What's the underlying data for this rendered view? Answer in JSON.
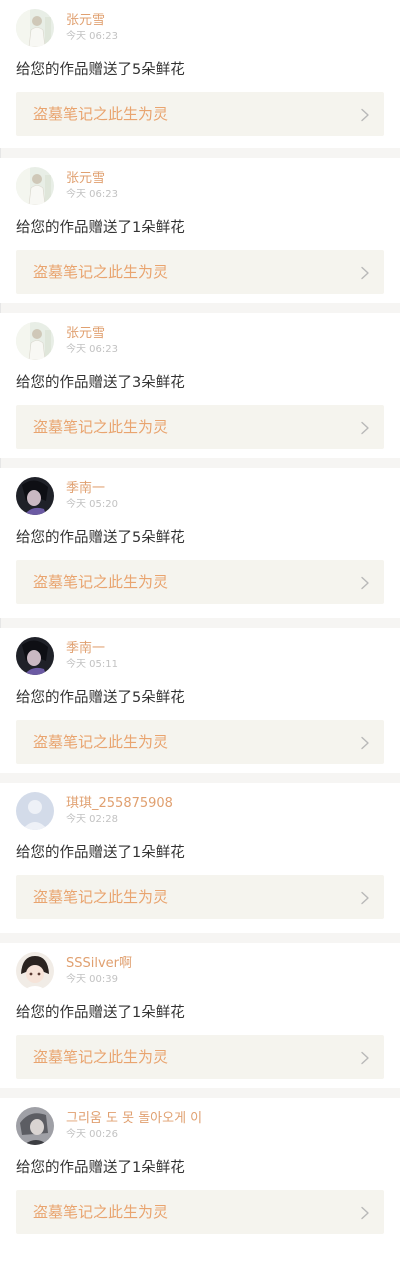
{
  "notifications": [
    {
      "username": "张元雪",
      "time": "今天 06:23",
      "message": "给您的作品赠送了5朵鲜花",
      "work_title": "盗墓笔记之此生为灵",
      "avatar": "avatar-light-figure"
    },
    {
      "username": "张元雪",
      "time": "今天 06:23",
      "message": "给您的作品赠送了1朵鲜花",
      "work_title": "盗墓笔记之此生为灵",
      "avatar": "avatar-light-figure"
    },
    {
      "username": "张元雪",
      "time": "今天 06:23",
      "message": "给您的作品赠送了3朵鲜花",
      "work_title": "盗墓笔记之此生为灵",
      "avatar": "avatar-light-figure"
    },
    {
      "username": "季南一",
      "time": "今天 05:20",
      "message": "给您的作品赠送了5朵鲜花",
      "work_title": "盗墓笔记之此生为灵",
      "avatar": "avatar-dark-portrait"
    },
    {
      "username": "季南一",
      "time": "今天 05:11",
      "message": "给您的作品赠送了5朵鲜花",
      "work_title": "盗墓笔记之此生为灵",
      "avatar": "avatar-dark-portrait"
    },
    {
      "username": "琪琪_255875908",
      "time": "今天 02:28",
      "message": "给您的作品赠送了1朵鲜花",
      "work_title": "盗墓笔记之此生为灵",
      "avatar": "avatar-default-user"
    },
    {
      "username": "SSSilver啊",
      "time": "今天 00:39",
      "message": "给您的作品赠送了1朵鲜花",
      "work_title": "盗墓笔记之此生为灵",
      "avatar": "avatar-anime-girl"
    },
    {
      "username": "그리움 도 못 돌아오게 이",
      "time": "今天 00:26",
      "message": "给您的作品赠送了1朵鲜花",
      "work_title": "盗墓笔记之此生为灵",
      "avatar": "avatar-grey-portrait"
    }
  ],
  "colors": {
    "username": "#e0a070",
    "work_title": "#e9a46f",
    "card_bg": "#f5f4ee",
    "divider": "#f6f5f3",
    "message": "#333333",
    "timestamp": "#c2c2c2"
  },
  "icons": {
    "chevron": "chevron-right-icon"
  }
}
